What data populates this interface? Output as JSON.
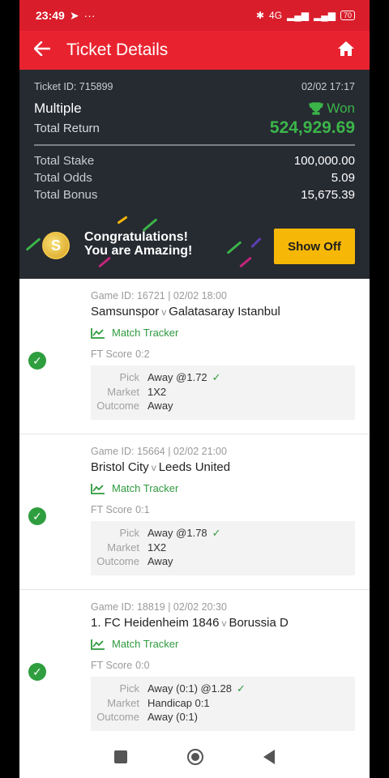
{
  "status": {
    "time": "23:49",
    "net": "4G",
    "battery": "70"
  },
  "header": {
    "title": "Ticket Details"
  },
  "summary": {
    "ticket_id": "Ticket ID: 715899",
    "datetime": "02/02 17:17",
    "type": "Multiple",
    "result": "Won",
    "total_return_label": "Total Return",
    "total_return": "524,929.69",
    "stake_label": "Total Stake",
    "stake": "100,000.00",
    "odds_label": "Total Odds",
    "odds": "5.09",
    "bonus_label": "Total Bonus",
    "bonus": "15,675.39"
  },
  "banner": {
    "line1": "Congratulations!",
    "line2": "You are Amazing!",
    "button": "Show Off",
    "coin": "S"
  },
  "bets": [
    {
      "game": "Game ID: 16721 | 02/02 18:00",
      "home": "Samsunspor",
      "away": "Galatasaray Istanbul",
      "tracker": "Match Tracker",
      "ft_label": "FT Score",
      "ft": "0:2",
      "pick_label": "Pick",
      "pick": "Away @1.72",
      "market_label": "Market",
      "market": "1X2",
      "outcome_label": "Outcome",
      "outcome": "Away"
    },
    {
      "game": "Game ID: 15664 | 02/02 21:00",
      "home": "Bristol City",
      "away": "Leeds United",
      "tracker": "Match Tracker",
      "ft_label": "FT Score",
      "ft": "0:1",
      "pick_label": "Pick",
      "pick": "Away @1.78",
      "market_label": "Market",
      "market": "1X2",
      "outcome_label": "Outcome",
      "outcome": "Away"
    },
    {
      "game": "Game ID: 18819 | 02/02 20:30",
      "home": "1. FC Heidenheim 1846",
      "away": "Borussia D",
      "tracker": "Match Tracker",
      "ft_label": "FT Score",
      "ft": "0:0",
      "pick_label": "Pick",
      "pick": "Away (0:1) @1.28",
      "market_label": "Market",
      "market": "Handicap 0:1",
      "outcome_label": "Outcome",
      "outcome": "Away (0:1)"
    }
  ],
  "vs": "v",
  "colors": {
    "brand_red": "#e8232f",
    "win_green": "#3bb54a",
    "show_off": "#f6b707"
  }
}
